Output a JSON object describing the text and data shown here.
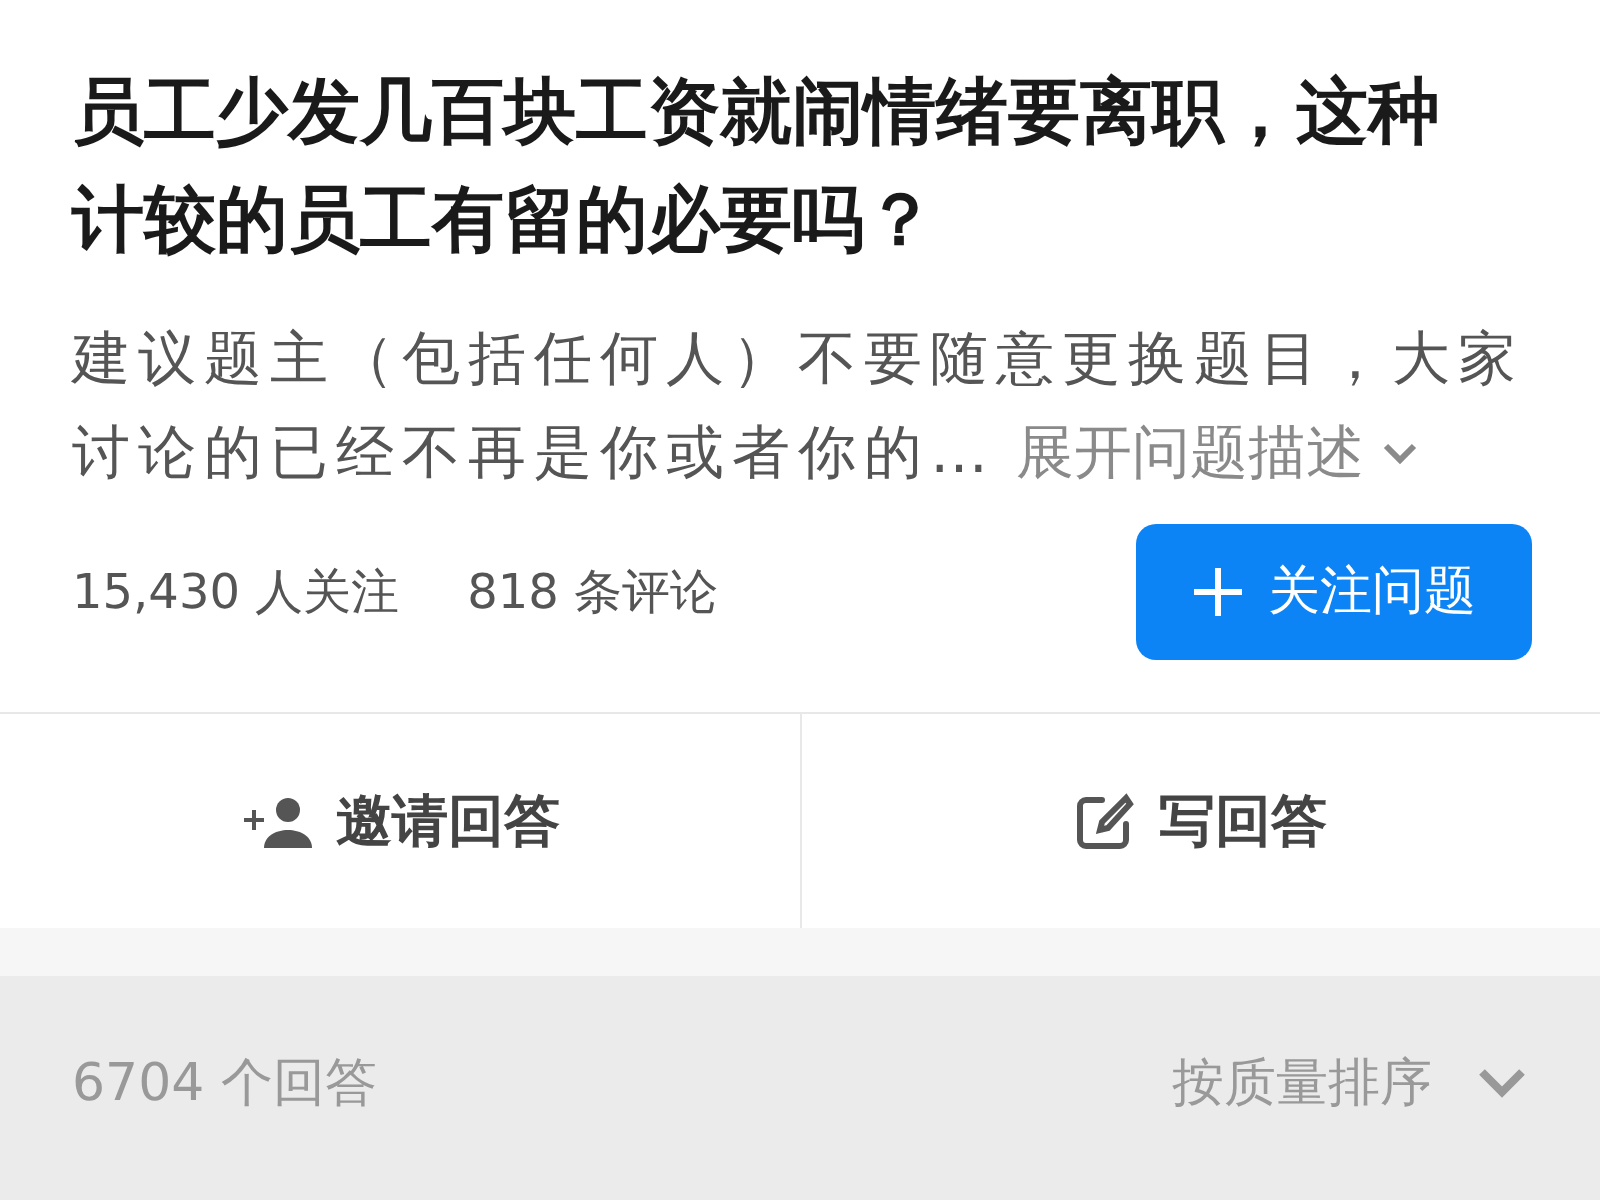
{
  "question": {
    "title": "员工少发几百块工资就闹情绪要离职，这种计较的员工有留的必要吗？",
    "description": "建议题主（包括任何人）不要随意更换题目，大家讨论的已经不再是你或者你的…",
    "expand_link": "展开问题描述"
  },
  "stats": {
    "followers": "15,430 人关注",
    "comments": "818 条评论"
  },
  "follow_button": {
    "label": "关注问题"
  },
  "actions": [
    {
      "kind": "invite",
      "label": "邀请回答"
    },
    {
      "kind": "write",
      "label": "写回答"
    }
  ],
  "answers_bar": {
    "count": "6704 个回答",
    "sort": "按质量排序"
  }
}
